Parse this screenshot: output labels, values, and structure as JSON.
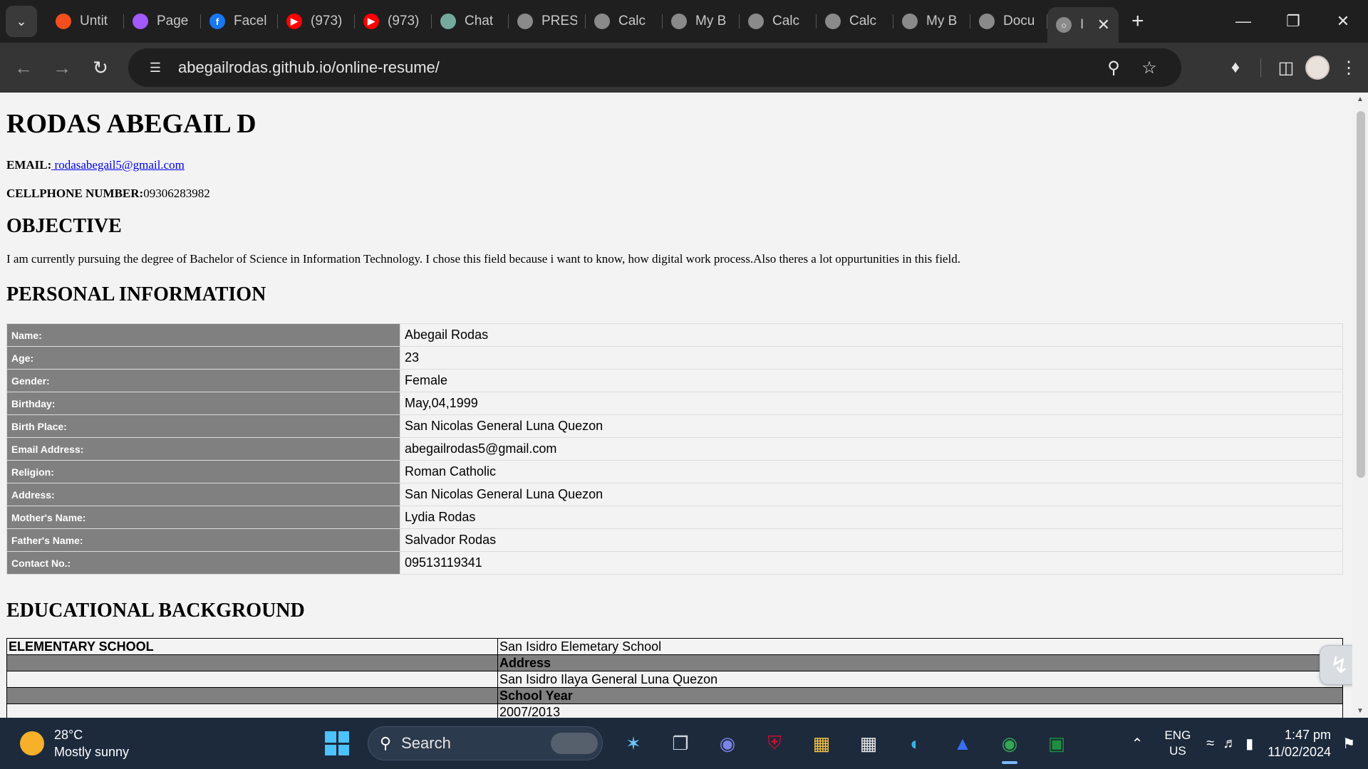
{
  "browser": {
    "tabs": [
      {
        "label": "Untit",
        "icon": "figma-icon",
        "color": "#f24e1e"
      },
      {
        "label": "Page",
        "icon": "figma-icon",
        "color": "#a259ff"
      },
      {
        "label": "Facel",
        "icon": "facebook-icon",
        "color": "#1877f2"
      },
      {
        "label": "(973)",
        "icon": "youtube-icon",
        "color": "#ff0000"
      },
      {
        "label": "(973)",
        "icon": "youtube-icon",
        "color": "#ff0000"
      },
      {
        "label": "Chat",
        "icon": "chatgpt-icon",
        "color": "#74aa9c"
      },
      {
        "label": "PRES",
        "icon": "globe-icon",
        "color": "#8a8a8a"
      },
      {
        "label": "Calc",
        "icon": "globe-icon",
        "color": "#8a8a8a"
      },
      {
        "label": "My B",
        "icon": "globe-icon",
        "color": "#8a8a8a"
      },
      {
        "label": "Calc",
        "icon": "globe-icon",
        "color": "#8a8a8a"
      },
      {
        "label": "Calc",
        "icon": "globe-icon",
        "color": "#8a8a8a"
      },
      {
        "label": "My B",
        "icon": "globe-icon",
        "color": "#8a8a8a"
      },
      {
        "label": "Docu",
        "icon": "globe-icon",
        "color": "#8a8a8a"
      }
    ],
    "active_tab": {
      "label": "I",
      "icon": "globe-icon"
    },
    "url": "abegailrodas.github.io/online-resume/"
  },
  "page": {
    "name": "RODAS ABEGAIL D",
    "email_label": "EMAIL:",
    "email": " rodasabegail5@gmail.com",
    "phone_label": "CELLPHONE NUMBER:",
    "phone": "09306283982",
    "objective_heading": "OBJECTIVE",
    "objective_text": "I am currently pursuing the degree of Bachelor of Science in Information Technology. I chose this field because i want to know, how digital work process.Also theres a lot oppurtunities in this field.",
    "personal_heading": "PERSONAL INFORMATION",
    "personal_info": [
      {
        "label": "Name:",
        "value": "Abegail Rodas"
      },
      {
        "label": "Age:",
        "value": "23"
      },
      {
        "label": "Gender:",
        "value": "Female"
      },
      {
        "label": "Birthday:",
        "value": "May,04,1999"
      },
      {
        "label": "Birth Place:",
        "value": "San Nicolas General Luna Quezon"
      },
      {
        "label": "Email Address:",
        "value": "abegailrodas5@gmail.com"
      },
      {
        "label": "Religion:",
        "value": "Roman Catholic"
      },
      {
        "label": "Address:",
        "value": "San Nicolas General Luna Quezon"
      },
      {
        "label": "Mother's Name:",
        "value": "Lydia Rodas"
      },
      {
        "label": "Father's Name:",
        "value": "Salvador Rodas"
      },
      {
        "label": "Contact No.:",
        "value": "09513119341"
      }
    ],
    "education_heading": "EDUCATIONAL BACKGROUND",
    "education": {
      "level": "ELEMENTARY SCHOOL",
      "school": "San Isidro Elemetary School",
      "address_label": "Address",
      "address": "San Isidro Ilaya General Luna Quezon",
      "year_label": "School Year",
      "year": "2007/2013"
    }
  },
  "taskbar": {
    "temperature": "28°C",
    "weather": "Mostly sunny",
    "search_placeholder": "Search",
    "lang_1": "ENG",
    "lang_2": "US",
    "time": "1:47 pm",
    "date": "11/02/2024"
  }
}
